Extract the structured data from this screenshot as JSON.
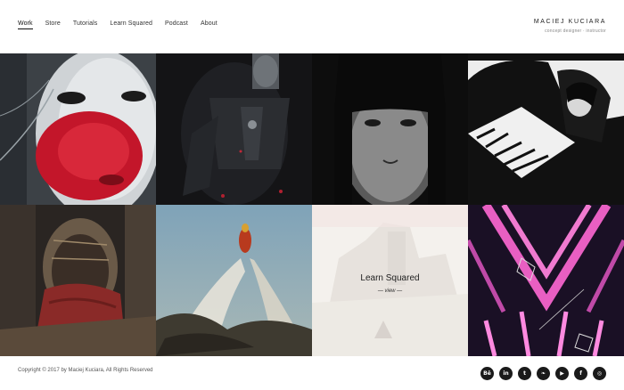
{
  "nav": {
    "items": [
      "Work",
      "Store",
      "Tutorials",
      "Learn Squared",
      "Podcast",
      "About"
    ],
    "active": "Work"
  },
  "brand": {
    "name": "MACIEJ KUCIARA",
    "tagline": "concept designer · instructor"
  },
  "grid": {
    "featured": {
      "title": "Learn Squared",
      "view_label": "— view —"
    }
  },
  "footer": {
    "copyright": "Copyright © 2017 by Maciej Kuciara, All Rights Reserved",
    "socials": [
      {
        "icon": "behance-icon",
        "glyph": "Bē"
      },
      {
        "icon": "linkedin-icon",
        "glyph": "in"
      },
      {
        "icon": "tumblr-icon",
        "glyph": "t"
      },
      {
        "icon": "twitter-icon",
        "glyph": "❧"
      },
      {
        "icon": "youtube-icon",
        "glyph": "▶"
      },
      {
        "icon": "facebook-icon",
        "glyph": "f"
      },
      {
        "icon": "instagram-icon",
        "glyph": "◎"
      }
    ]
  }
}
